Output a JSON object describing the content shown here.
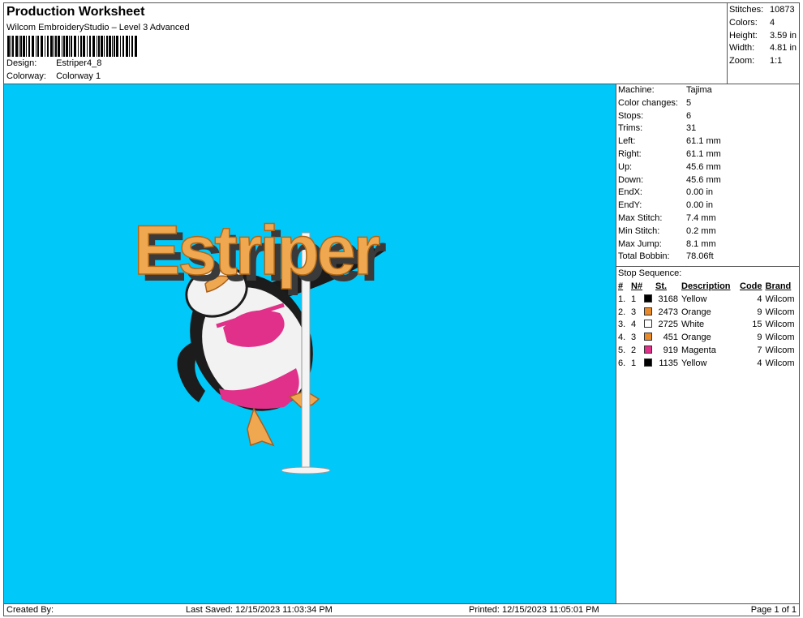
{
  "header": {
    "title": "Production Worksheet",
    "subtitle": "Wilcom EmbroideryStudio – Level 3 Advanced",
    "design_label": "Design:",
    "design_value": "Estriper4_8",
    "colorway_label": "Colorway:",
    "colorway_value": "Colorway 1"
  },
  "stats": [
    {
      "k": "Stitches:",
      "v": "10873"
    },
    {
      "k": "Colors:",
      "v": "4"
    },
    {
      "k": "Height:",
      "v": "3.59 in"
    },
    {
      "k": "Width:",
      "v": "4.81 in"
    },
    {
      "k": "Zoom:",
      "v": "1:1"
    }
  ],
  "info": [
    {
      "k": "Machine:",
      "v": "Tajima"
    },
    {
      "k": "Color changes:",
      "v": "5"
    },
    {
      "k": "Stops:",
      "v": "6"
    },
    {
      "k": "Trims:",
      "v": "31"
    },
    {
      "k": "Left:",
      "v": "61.1 mm"
    },
    {
      "k": "Right:",
      "v": "61.1 mm"
    },
    {
      "k": "Up:",
      "v": "45.6 mm"
    },
    {
      "k": "Down:",
      "v": "45.6 mm"
    },
    {
      "k": "EndX:",
      "v": "0.00 in"
    },
    {
      "k": "EndY:",
      "v": "0.00 in"
    },
    {
      "k": "Max Stitch:",
      "v": "7.4 mm"
    },
    {
      "k": "Min Stitch:",
      "v": "0.2 mm"
    },
    {
      "k": "Max Jump:",
      "v": "8.1 mm"
    },
    {
      "k": "Total Bobbin:",
      "v": "78.06ft"
    }
  ],
  "stop_sequence": {
    "title": "Stop Sequence:",
    "headers": {
      "idx": "#",
      "n": "N#",
      "st": "St.",
      "desc": "Description",
      "code": "Code",
      "brand": "Brand"
    },
    "rows": [
      {
        "idx": "1.",
        "n": "1",
        "color": "#000000",
        "st": "3168",
        "desc": "Yellow",
        "code": "4",
        "brand": "Wilcom"
      },
      {
        "idx": "2.",
        "n": "3",
        "color": "#e8892a",
        "st": "2473",
        "desc": "Orange",
        "code": "9",
        "brand": "Wilcom"
      },
      {
        "idx": "3.",
        "n": "4",
        "color": "#ffffff",
        "st": "2725",
        "desc": "White",
        "code": "15",
        "brand": "Wilcom"
      },
      {
        "idx": "4.",
        "n": "3",
        "color": "#e8892a",
        "st": "451",
        "desc": "Orange",
        "code": "9",
        "brand": "Wilcom"
      },
      {
        "idx": "5.",
        "n": "2",
        "color": "#e0308a",
        "st": "919",
        "desc": "Magenta",
        "code": "7",
        "brand": "Wilcom"
      },
      {
        "idx": "6.",
        "n": "1",
        "color": "#000000",
        "st": "1135",
        "desc": "Yellow",
        "code": "4",
        "brand": "Wilcom"
      }
    ]
  },
  "design": {
    "text": "Estriper",
    "background": "#00c8f8",
    "text_color": "#f0a850",
    "shadow_color": "#3a3a3a"
  },
  "footer": {
    "created_by": "Created By:",
    "last_saved": "Last Saved: 12/15/2023 11:03:34 PM",
    "printed": "Printed: 12/15/2023 11:05:01 PM",
    "page": "Page 1 of 1"
  }
}
